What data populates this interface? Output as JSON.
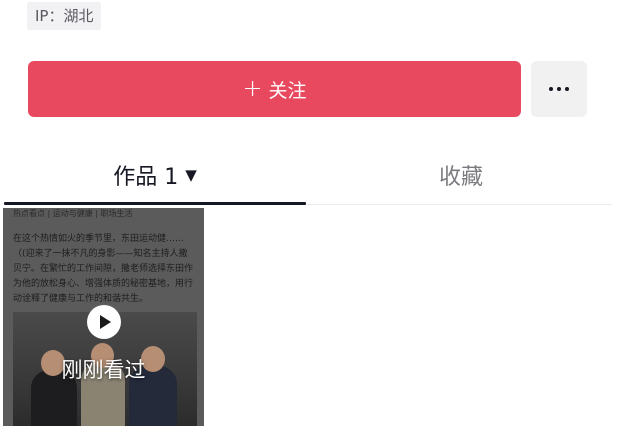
{
  "profile": {
    "ip_location": "IP：湖北"
  },
  "actions": {
    "follow_label": "关注",
    "follow_plus": "+",
    "more_icon": "more-dots-icon"
  },
  "tabs": {
    "works_label": "作品 1",
    "works_arrow": "▼",
    "favorites_label": "收藏"
  },
  "video": {
    "headline": "热点看点 | 运动与健康 | 职场生活",
    "article_text": "在这个热情如火的季节里，东田运动健……（(迎来了一抹不凡的身影——知名主持人撒贝宁。在繁忙的工作间隙，撒老师选择东田作为他的放松身心、增强体质的秘密基地，用行动诠释了健康与工作的和谐共生。",
    "overlay_label": "刚刚看过",
    "play_icon": "play-icon"
  },
  "colors": {
    "follow_button": "#e8495f",
    "more_button_bg": "#f1f1f2",
    "active_tab_text": "#161823",
    "inactive_tab_text": "#7b7b80"
  }
}
